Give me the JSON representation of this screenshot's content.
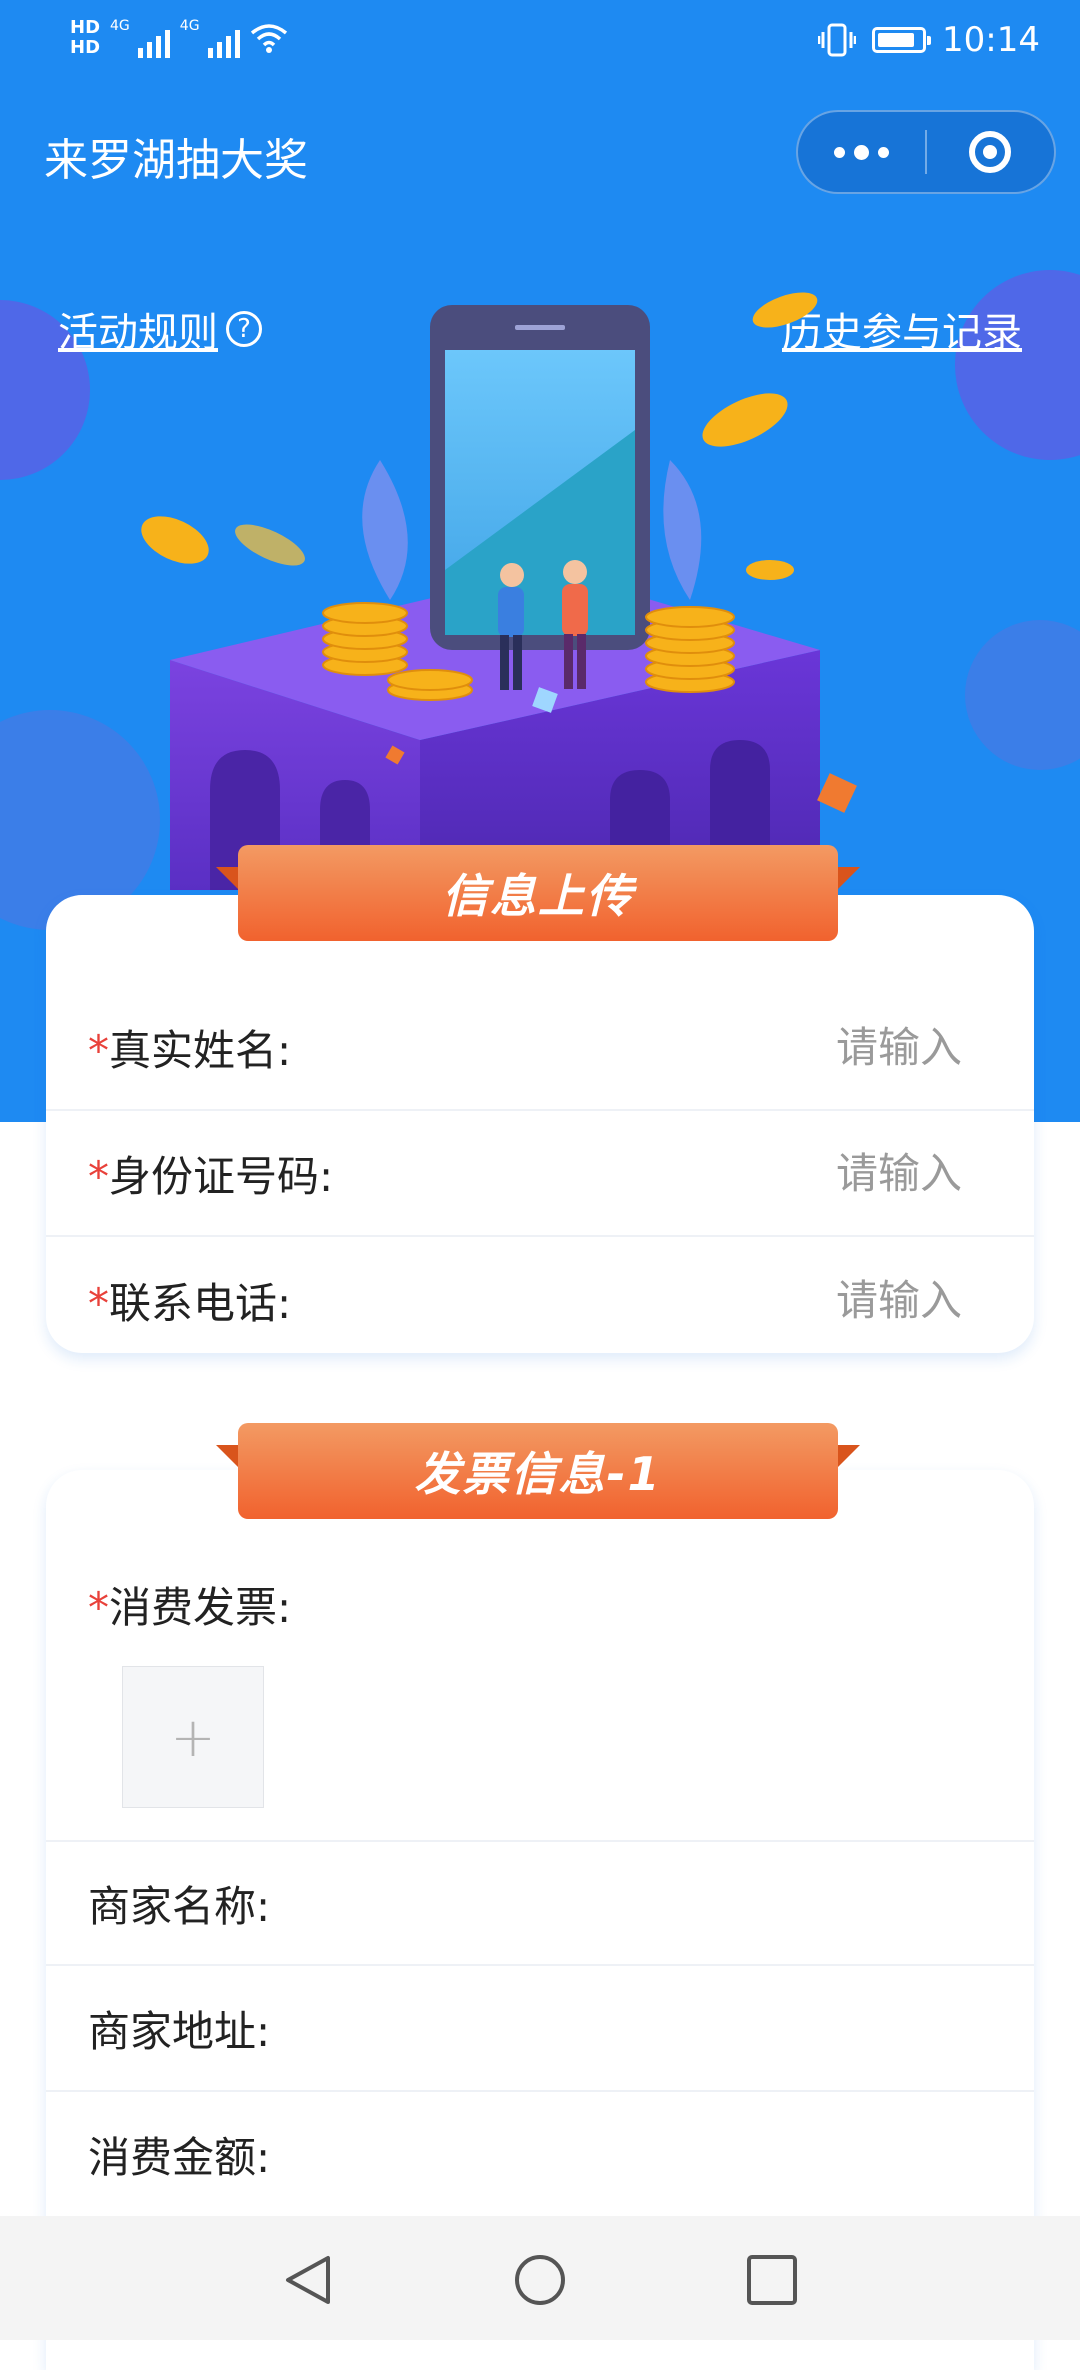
{
  "status_bar": {
    "hd1": "HD",
    "hd2": "HD",
    "net1": "4G",
    "net2": "4G",
    "time": "10:14",
    "icons": [
      "hd-icon",
      "signal-icon",
      "wifi-icon",
      "vibrate-icon",
      "battery-icon"
    ]
  },
  "nav": {
    "title": "来罗湖抽大奖",
    "more_icon": "more-dots-icon",
    "close_icon": "target-close-icon"
  },
  "links": {
    "rules": "活动规则",
    "rules_icon": "?",
    "history": "历史参与记录"
  },
  "section1": {
    "title": "信息上传",
    "fields": [
      {
        "required": "*",
        "label": "真实姓名:",
        "placeholder": "请输入",
        "value": ""
      },
      {
        "required": "*",
        "label": "身份证号码:",
        "placeholder": "请输入",
        "value": ""
      },
      {
        "required": "*",
        "label": "联系电话:",
        "placeholder": "请输入",
        "value": ""
      }
    ]
  },
  "section2": {
    "title": "发票信息-1",
    "upload": {
      "required": "*",
      "label": "消费发票:",
      "plus": "+"
    },
    "fields": [
      {
        "label": "商家名称:"
      },
      {
        "label": "商家地址:"
      },
      {
        "label": "消费金额:"
      }
    ]
  },
  "colors": {
    "hero_blue": "#1e8af2",
    "ribbon_orange": "#f1622e",
    "required_red": "#e8413a"
  }
}
